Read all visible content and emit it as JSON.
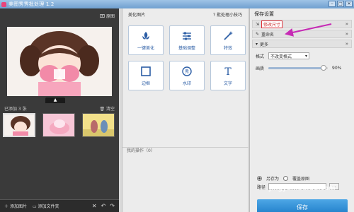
{
  "window": {
    "title": "美图秀秀批处理 1.2",
    "buttons": [
      "‒",
      "□",
      "✕"
    ]
  },
  "left_panel": {
    "original_label": "原图",
    "collapse_arrow": "▲",
    "added_count": "已添加 3 张",
    "clear_label": "清空",
    "footer": {
      "add_image": "添加图片",
      "add_folder": "添加文件夹"
    }
  },
  "middle_panel": {
    "title": "美化图片",
    "tips_label": "批处理小技巧",
    "tools": [
      {
        "label": "一键美化",
        "icon": "sparkle-icon"
      },
      {
        "label": "基础调整",
        "icon": "sliders-icon"
      },
      {
        "label": "特效",
        "icon": "magic-wand-icon"
      },
      {
        "label": "边框",
        "icon": "frame-icon"
      },
      {
        "label": "水印",
        "icon": "watermark-icon"
      },
      {
        "label": "文字",
        "icon": "text-icon"
      }
    ],
    "history_label": "我的操作（0）"
  },
  "right_panel": {
    "title": "保存设置",
    "sections": {
      "resize": "修改尺寸",
      "rename": "重命名",
      "more": "更多"
    },
    "format_label": "格式",
    "format_value": "不改变格式",
    "quality_label": "画质",
    "quality_value": "90%",
    "quality_fraction": 0.9,
    "save_as_label": "另存为",
    "overwrite_label": "覆盖原图",
    "path_label": "路径",
    "browse_label": "...",
    "save_button_label": "保存"
  },
  "watermark_text": "jingyan.baidu.com",
  "colors": {
    "title_bar": "#7fb0df",
    "left_bg": "#3a3a3a",
    "accent_blue": "#2b5da5",
    "save_button": "#2a8ad6",
    "annotation": "#c62bb5"
  }
}
